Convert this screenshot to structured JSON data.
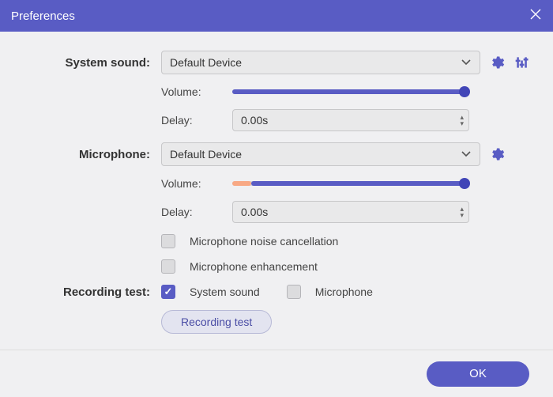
{
  "window": {
    "title": "Preferences"
  },
  "sections": {
    "systemSound": {
      "label": "System sound:",
      "device": "Default Device",
      "volumeLabel": "Volume:",
      "volumePercent": 98,
      "delayLabel": "Delay:",
      "delayValue": "0.00s"
    },
    "microphone": {
      "label": "Microphone:",
      "device": "Default Device",
      "volumeLabel": "Volume:",
      "levelPercent": 8,
      "volumePercent": 98,
      "delayLabel": "Delay:",
      "delayValue": "0.00s",
      "noiseCancellation": {
        "label": "Microphone noise cancellation",
        "checked": false
      },
      "enhancement": {
        "label": "Microphone enhancement",
        "checked": false
      }
    },
    "recordingTest": {
      "label": "Recording test:",
      "systemSound": {
        "label": "System sound",
        "checked": true
      },
      "microphone": {
        "label": "Microphone",
        "checked": false
      },
      "buttonLabel": "Recording test"
    }
  },
  "footer": {
    "ok": "OK"
  },
  "colors": {
    "accent": "#595cc4",
    "panel": "#f0f0f2"
  }
}
